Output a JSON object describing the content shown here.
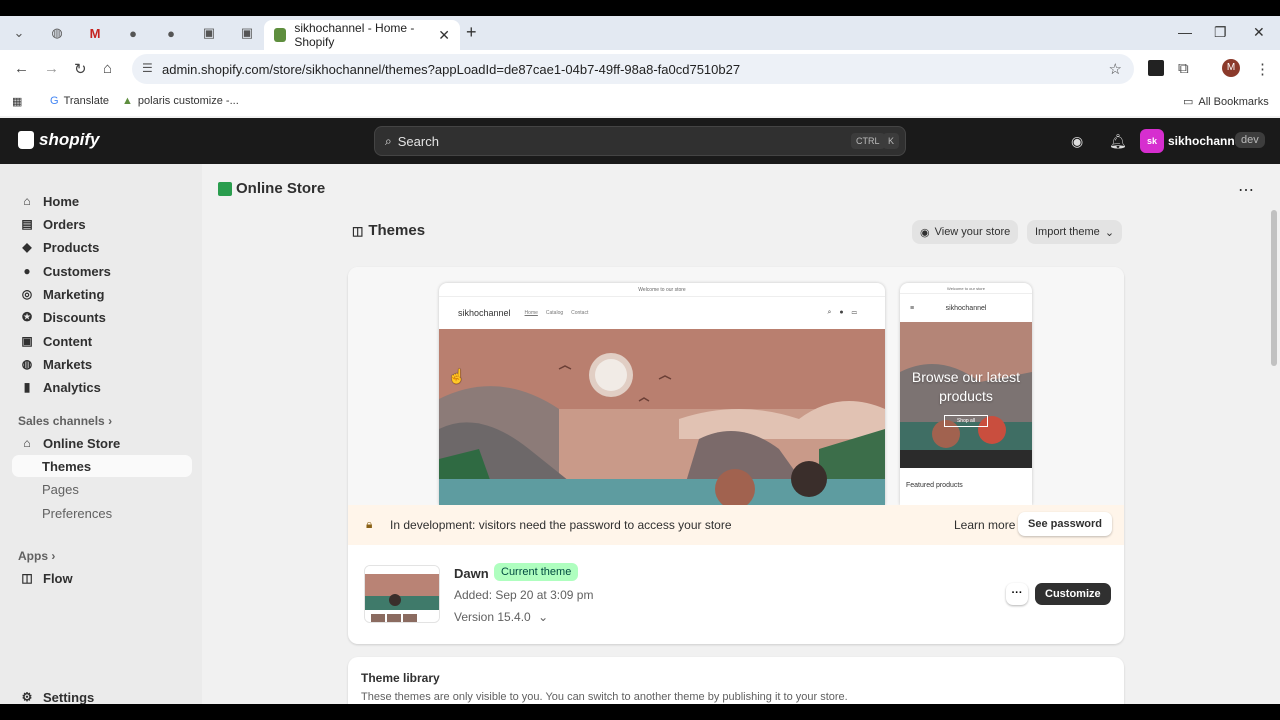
{
  "browser": {
    "active_tab_title": "sikhochannel - Home - Shopify",
    "url": "admin.shopify.com/store/sikhochannel/themes?appLoadId=de87cae1-04b7-49ff-98a8-fa0cd7510b27",
    "profile_initial": "M",
    "bookmarks": [
      "Translate",
      "polaris customize -..."
    ],
    "all_bookmarks": "All Bookmarks"
  },
  "topbar": {
    "logo": "shopify",
    "search_placeholder": "Search",
    "kbd_ctrl": "CTRL",
    "kbd_k": "K",
    "avatar_initials": "sk",
    "store_name": "sikhochannel",
    "badge": "dev"
  },
  "sidebar": {
    "items": [
      "Home",
      "Orders",
      "Products",
      "Customers",
      "Marketing",
      "Discounts",
      "Content",
      "Markets",
      "Analytics"
    ],
    "sales_channels_label": "Sales channels",
    "online_store": "Online Store",
    "sub_items": [
      "Themes",
      "Pages",
      "Preferences"
    ],
    "apps_label": "Apps",
    "flow": "Flow",
    "settings": "Settings"
  },
  "main": {
    "page_title": "Online Store",
    "section_title": "Themes",
    "view_store": "View your store",
    "import_theme": "Import theme",
    "preview": {
      "announcement": "Welcome to our store",
      "store_name": "sikhochannel",
      "links": [
        "Home",
        "Catalog",
        "Contact"
      ],
      "mobile_headline": "Browse our latest products",
      "shop_all": "Shop all",
      "featured": "Featured products"
    },
    "banner": {
      "message": "In development: visitors need the password to access your store",
      "learn_more": "Learn more",
      "see_password": "See password"
    },
    "current": {
      "name": "Dawn",
      "badge": "Current theme",
      "added": "Added: Sep 20 at 3:09 pm",
      "version": "Version 15.4.0",
      "customize": "Customize"
    },
    "library": {
      "title": "Theme library",
      "description": "These themes are only visible to you. You can switch to another theme by publishing it to your store."
    }
  }
}
